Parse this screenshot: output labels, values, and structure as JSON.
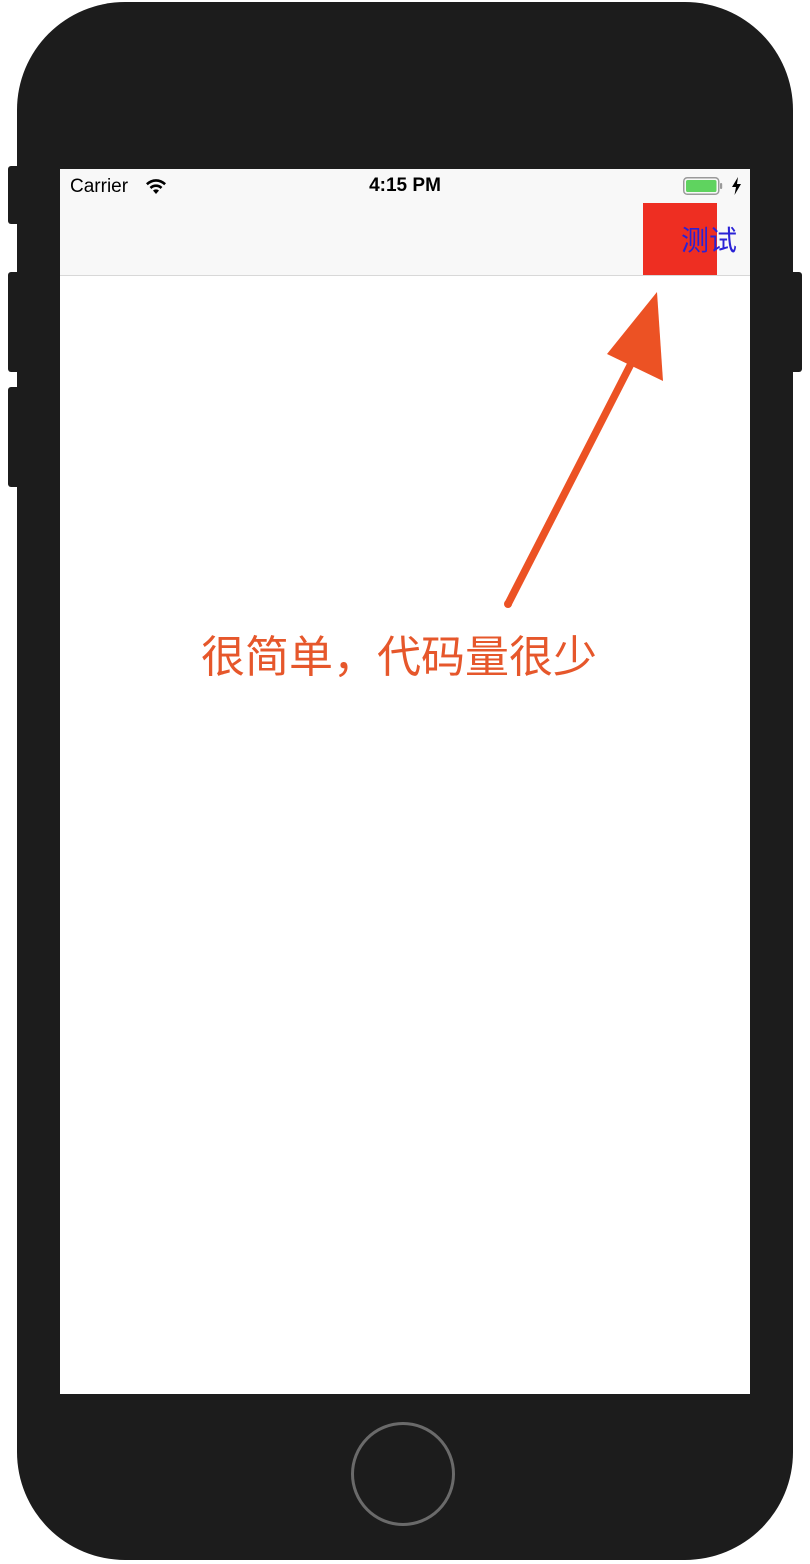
{
  "status_bar": {
    "carrier": "Carrier",
    "time": "4:15 PM",
    "wifi_icon": "wifi-icon",
    "battery_icon": "battery-full-icon",
    "charging_icon": "charging-bolt-icon",
    "battery_color": "#5fd35f"
  },
  "nav_bar": {
    "right_button_label": "测试",
    "right_button_color": "#2a22d6",
    "highlight_color": "#ee2e22"
  },
  "annotation": {
    "caption": "很简单，代码量很少",
    "color": "#e6572b",
    "arrow_icon": "arrow-up-right-icon"
  },
  "device": {
    "home_button_icon": "home-button-icon",
    "frame_color": "#1c1c1c"
  }
}
